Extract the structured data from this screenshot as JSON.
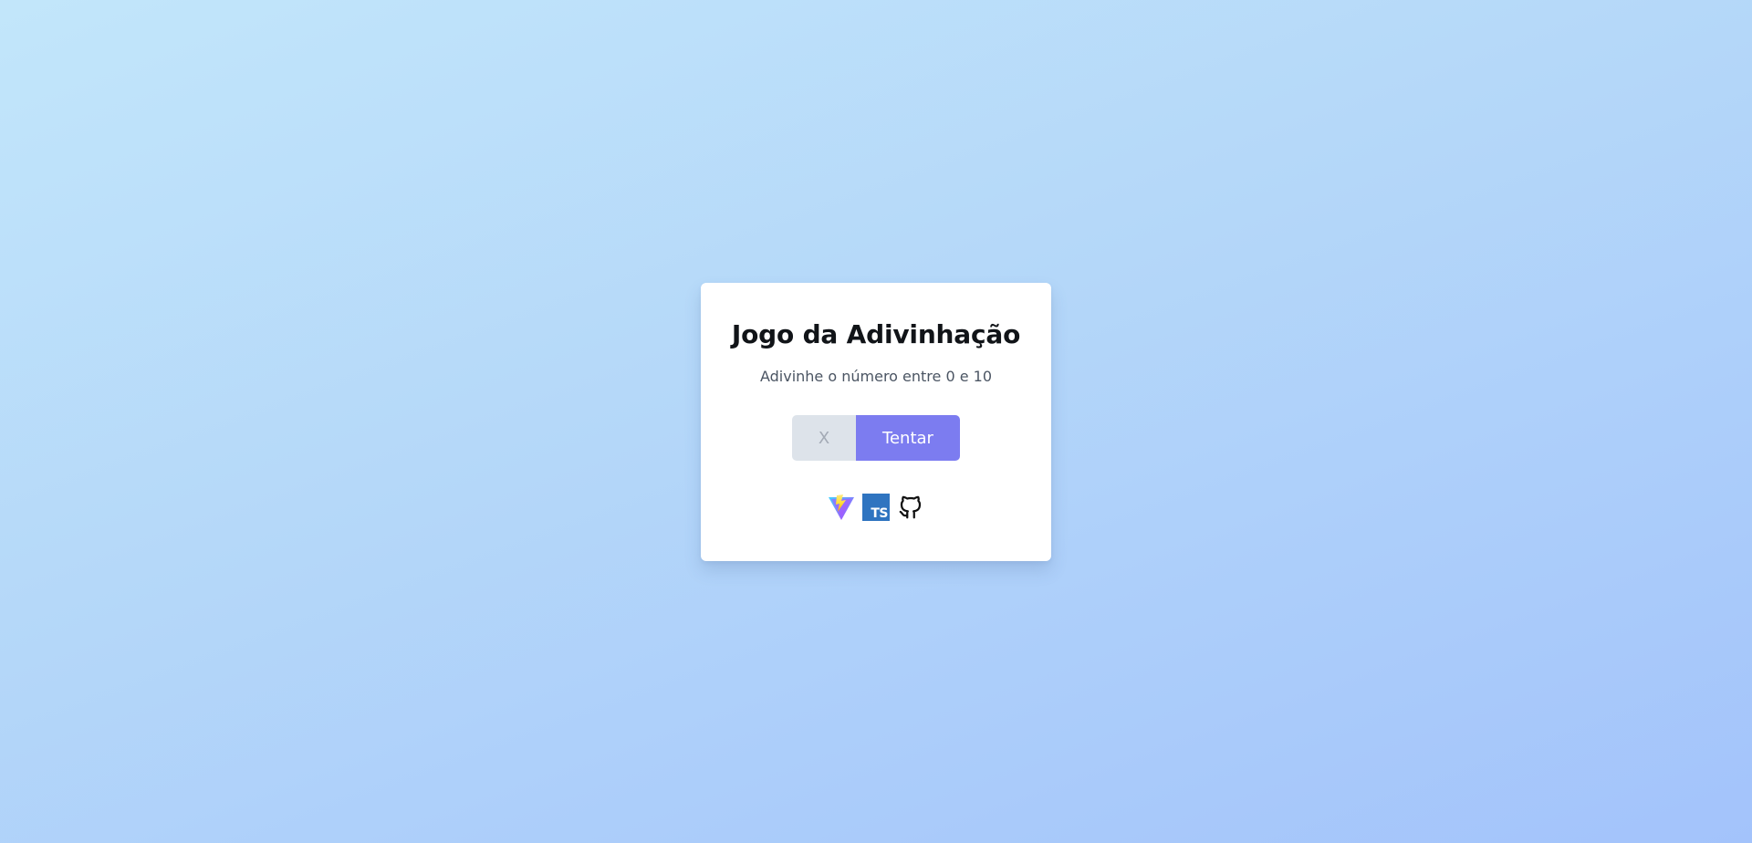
{
  "card": {
    "title": "Jogo da Adivinhação",
    "subtitle": "Adivinhe o número entre 0 e 10"
  },
  "form": {
    "input_placeholder": "X",
    "input_value": "",
    "button_label": "Tentar"
  },
  "icons": [
    {
      "name": "vite-icon"
    },
    {
      "name": "typescript-icon",
      "text": "TS"
    },
    {
      "name": "github-icon"
    }
  ],
  "colors": {
    "background_start": "#c2e6fa",
    "background_end": "#a3c3fb",
    "card": "#ffffff",
    "input_background": "#dde3ea",
    "button": "#7c7cf0",
    "typescript": "#2f74c0"
  }
}
